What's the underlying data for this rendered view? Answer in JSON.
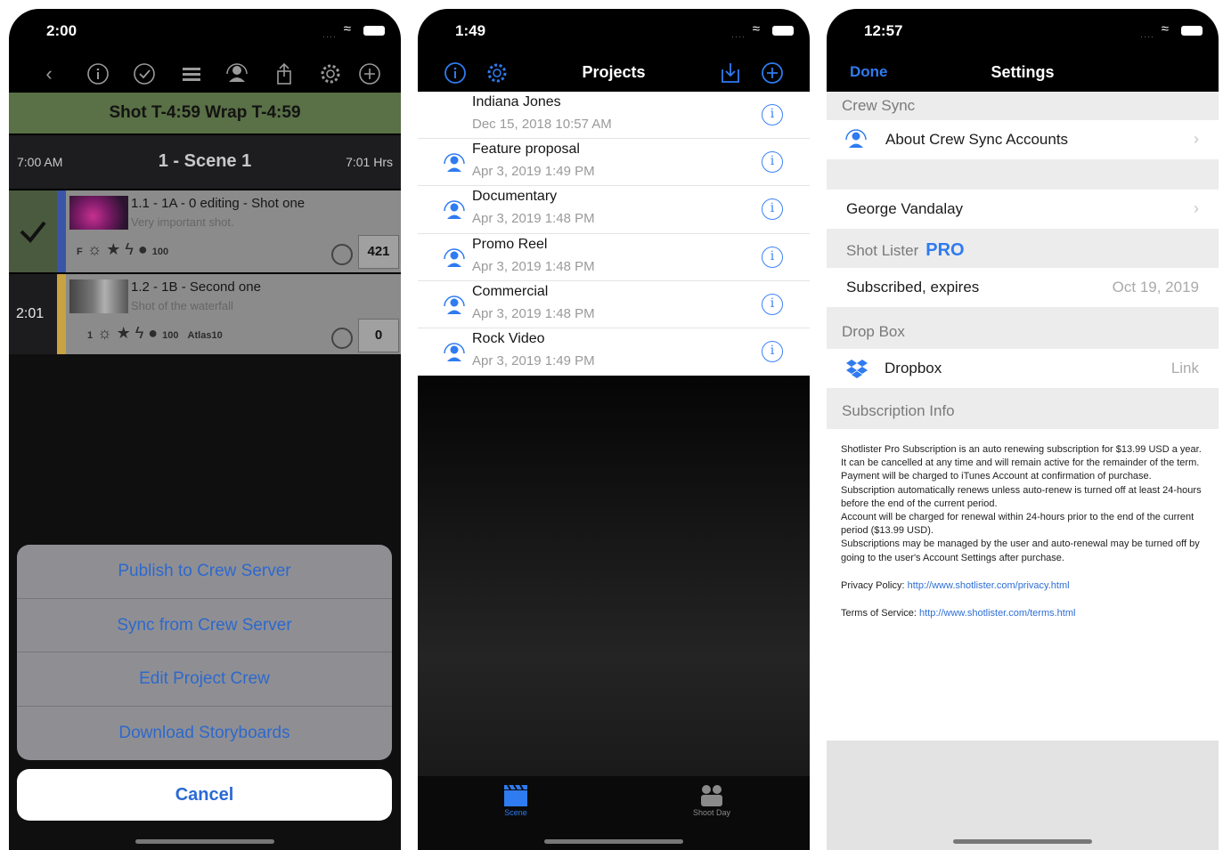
{
  "phone1": {
    "status_time": "2:00",
    "banner": "Shot T-4:59  Wrap T-4:59",
    "scene": {
      "start": "7:00 AM",
      "title": "1 - Scene 1",
      "hours": "7:01 Hrs"
    },
    "shots": [
      {
        "title": "1.1 - 1A - 0 editing - Shot one",
        "subtitle": "Very important shot.",
        "prefix": "F",
        "num": "100",
        "lens": "",
        "count": "421",
        "left": "✓"
      },
      {
        "title": "1.2 - 1B - Second one",
        "subtitle": "Shot of the waterfall",
        "prefix": "1",
        "num": "100",
        "lens": "Atlas10",
        "count": "0",
        "left": "2:01"
      }
    ],
    "action_sheet": [
      "Publish to Crew Server",
      "Sync from Crew Server",
      "Edit Project Crew",
      "Download Storyboards"
    ],
    "cancel": "Cancel"
  },
  "phone2": {
    "status_time": "1:49",
    "title": "Projects",
    "projects": [
      {
        "name": "Indiana Jones",
        "date": "Dec 15, 2018 10:57 AM",
        "shared": false
      },
      {
        "name": "Feature proposal",
        "date": "Apr 3, 2019 1:49 PM",
        "shared": true
      },
      {
        "name": "Documentary",
        "date": "Apr 3, 2019 1:48 PM",
        "shared": true
      },
      {
        "name": "Promo Reel",
        "date": "Apr 3, 2019 1:48 PM",
        "shared": true
      },
      {
        "name": "Commercial",
        "date": "Apr 3, 2019 1:48 PM",
        "shared": true
      },
      {
        "name": "Rock Video",
        "date": "Apr 3, 2019 1:49 PM",
        "shared": true
      }
    ],
    "tabs": [
      {
        "label": "Scene",
        "icon": "clapperboard-icon",
        "active": true
      },
      {
        "label": "Shoot Day",
        "icon": "crew-icon",
        "active": false
      }
    ]
  },
  "phone3": {
    "status_time": "12:57",
    "done": "Done",
    "title": "Settings",
    "crew_sync_header": "Crew Sync",
    "about_crew_sync": "About Crew Sync Accounts",
    "user_name": "George Vandalay",
    "shot_lister_header": "Shot Lister",
    "pro_label": "PRO",
    "subscribed_label": "Subscribed, expires",
    "subscribed_date": "Oct 19, 2019",
    "dropbox_header": "Drop Box",
    "dropbox_label": "Dropbox",
    "dropbox_value": "Link",
    "subscription_header": "Subscription Info",
    "subscription_text": [
      "Shotlister Pro Subscription is an auto renewing subscription for $13.99 USD a year.",
      "It can be cancelled at any time and will remain active for the remainder of the term.",
      "Payment will be charged to iTunes Account at confirmation of purchase.",
      "Subscription automatically renews unless auto-renew is turned off at least 24-hours before the end of the current period.",
      "Account will be charged for renewal within 24-hours prior to the end of the current period ($13.99 USD).",
      "Subscriptions may be managed by the user and auto-renewal may be turned off by going to the user's Account Settings after purchase."
    ],
    "privacy_label": "Privacy Policy:",
    "privacy_url": "http://www.shotlister.com/privacy.html",
    "terms_label": "Terms of Service:",
    "terms_url": "http://www.shotlister.com/terms.html"
  },
  "colors": {
    "accent_blue": "#2f7bf0",
    "banner_green": "#5a7046",
    "shot1_stripe": "#3a55a8",
    "shot2_stripe": "#c9a341"
  }
}
